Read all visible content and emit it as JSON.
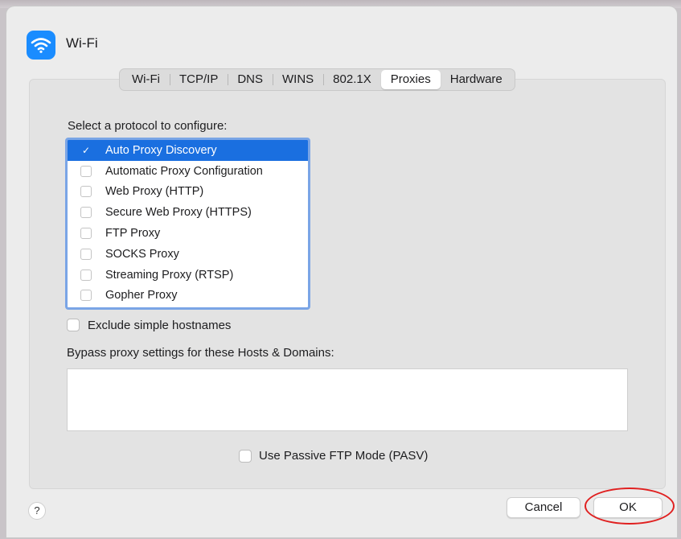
{
  "window": {
    "title": "Wi-Fi",
    "icon": "wifi-icon",
    "accent": "#1a8cff"
  },
  "tabs": [
    {
      "label": "Wi-Fi",
      "active": false
    },
    {
      "label": "TCP/IP",
      "active": false
    },
    {
      "label": "DNS",
      "active": false
    },
    {
      "label": "WINS",
      "active": false
    },
    {
      "label": "802.1X",
      "active": false
    },
    {
      "label": "Proxies",
      "active": true
    },
    {
      "label": "Hardware",
      "active": false
    }
  ],
  "protocols": {
    "heading": "Select a protocol to configure:",
    "items": [
      {
        "label": "Auto Proxy Discovery",
        "checked": true,
        "selected": true
      },
      {
        "label": "Automatic Proxy Configuration",
        "checked": false,
        "selected": false
      },
      {
        "label": "Web Proxy (HTTP)",
        "checked": false,
        "selected": false
      },
      {
        "label": "Secure Web Proxy (HTTPS)",
        "checked": false,
        "selected": false
      },
      {
        "label": "FTP Proxy",
        "checked": false,
        "selected": false
      },
      {
        "label": "SOCKS Proxy",
        "checked": false,
        "selected": false
      },
      {
        "label": "Streaming Proxy (RTSP)",
        "checked": false,
        "selected": false
      },
      {
        "label": "Gopher Proxy",
        "checked": false,
        "selected": false
      }
    ],
    "selection_color": "#1a6fe0"
  },
  "options": {
    "exclude_simple_label": "Exclude simple hostnames",
    "exclude_simple_checked": false,
    "bypass_label": "Bypass proxy settings for these Hosts & Domains:",
    "bypass_value": "",
    "passive_ftp_label": "Use Passive FTP Mode (PASV)",
    "passive_ftp_checked": false
  },
  "footer": {
    "help_label": "?",
    "cancel_label": "Cancel",
    "ok_label": "OK",
    "highlight_color": "#e02020"
  }
}
